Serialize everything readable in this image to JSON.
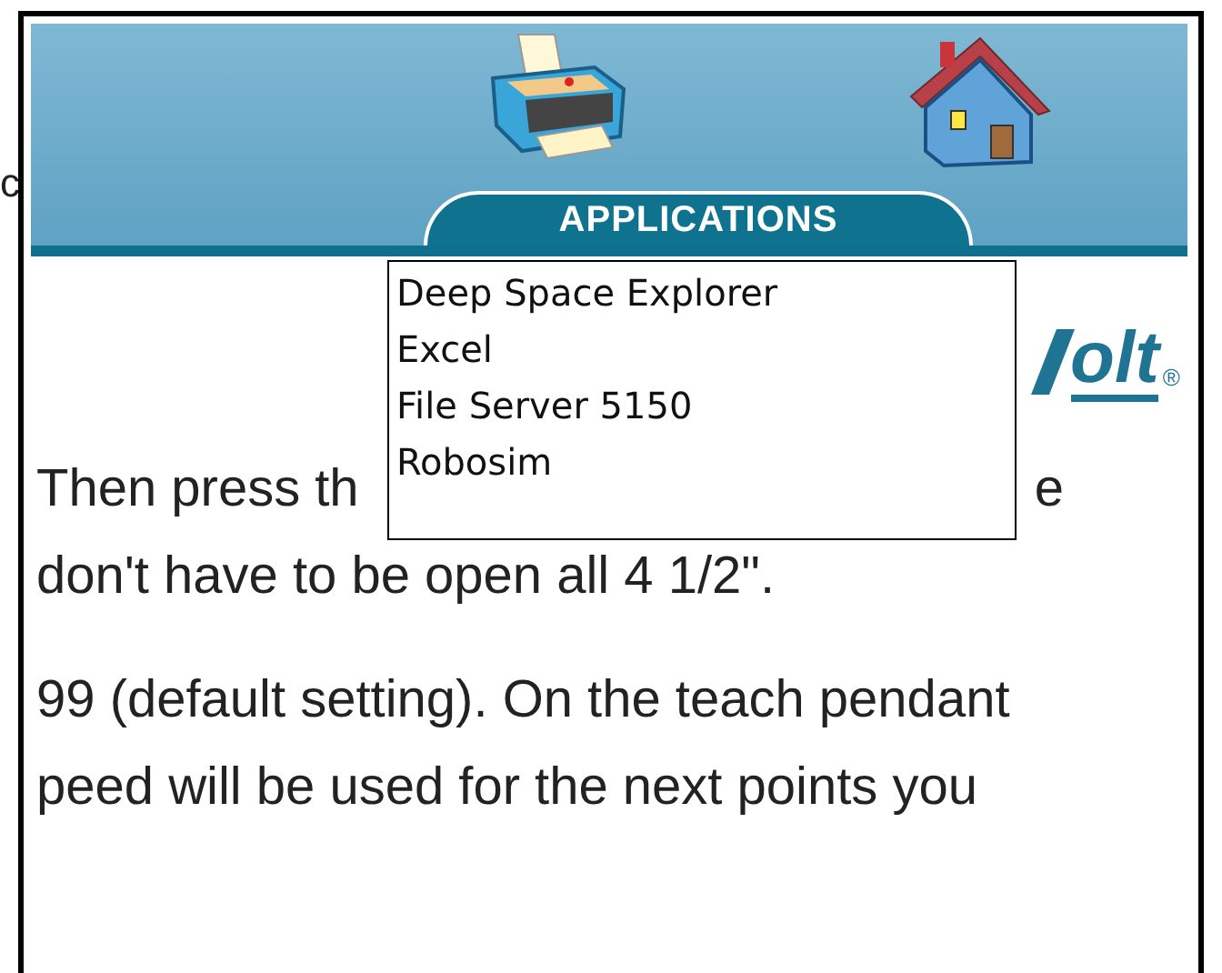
{
  "edge_text": "c",
  "header": {
    "tab": {
      "label": "APPLICATIONS"
    }
  },
  "logo": {
    "text": "olt",
    "mark": "®"
  },
  "menu": {
    "items": [
      {
        "label": "Deep Space Explorer"
      },
      {
        "label": "Excel"
      },
      {
        "label": "File Server 5150"
      },
      {
        "label": "Robosim"
      }
    ]
  },
  "paragraphs": [
    {
      "lines": [
        {
          "segments": [
            "Then press th",
            "e"
          ]
        },
        {
          "segments": [
            "don't have to be open all 4 1/2\"."
          ]
        }
      ]
    },
    {
      "lines": [
        {
          "segments": [
            "99 (default setting). On the teach pendant"
          ]
        },
        {
          "segments": [
            "peed will be used for the next points you"
          ]
        }
      ]
    }
  ]
}
